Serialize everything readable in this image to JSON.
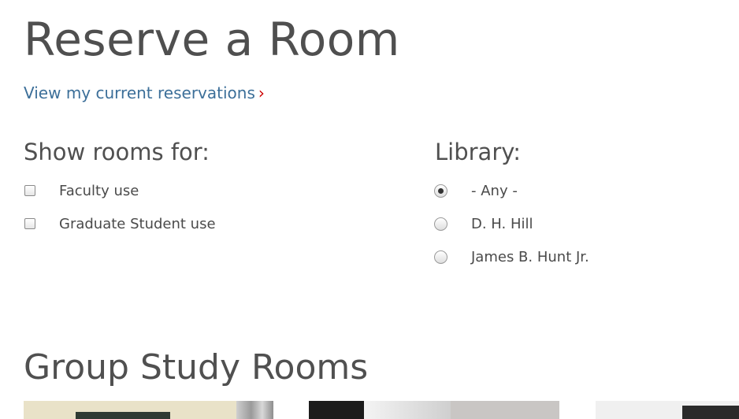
{
  "page": {
    "title": "Reserve a Room",
    "reservations_link": "View my current reservations",
    "reservations_chevron": "›"
  },
  "filters": {
    "show_rooms": {
      "heading": "Show rooms for:",
      "options": [
        {
          "label": "Faculty use",
          "checked": false
        },
        {
          "label": "Graduate Student use",
          "checked": false
        }
      ]
    },
    "library": {
      "heading": "Library:",
      "options": [
        {
          "label": "- Any -",
          "selected": true
        },
        {
          "label": "D. H. Hill",
          "selected": false
        },
        {
          "label": "James B. Hunt Jr.",
          "selected": false
        }
      ]
    }
  },
  "sections": {
    "group_study_title": "Group Study Rooms"
  },
  "colors": {
    "link": "#3c6f99",
    "chevron": "#cc0000",
    "heading": "#4f4f4f"
  }
}
